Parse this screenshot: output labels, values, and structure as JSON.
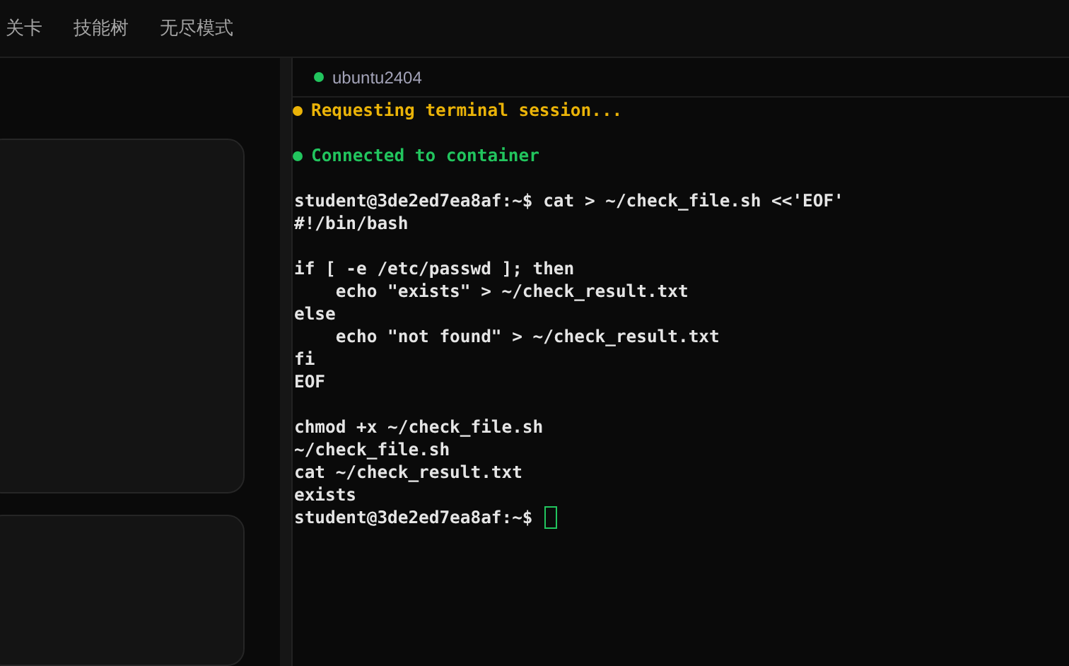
{
  "nav": [
    {
      "label": "关卡"
    },
    {
      "label": "技能树"
    },
    {
      "label": "无尽模式"
    }
  ],
  "terminal": {
    "tab": {
      "label": "ubuntu2404",
      "color": "#22c55e"
    },
    "blocks": [
      {
        "lines": [
          {
            "kind": "status",
            "text": "Requesting terminal session...",
            "color": "#eab308"
          }
        ]
      },
      {
        "lines": [
          {
            "kind": "status",
            "text": "Connected to container",
            "color": "#22c55e"
          }
        ]
      },
      {
        "lines": [
          {
            "kind": "text",
            "text": "student@3de2ed7ea8af:~$ cat > ~/check_file.sh <<'EOF'"
          },
          {
            "kind": "text",
            "text": "#!/bin/bash"
          }
        ]
      },
      {
        "lines": [
          {
            "kind": "text",
            "text": "if [ -e /etc/passwd ]; then"
          },
          {
            "kind": "text",
            "text": "    echo \"exists\" > ~/check_result.txt"
          },
          {
            "kind": "text",
            "text": "else"
          },
          {
            "kind": "text",
            "text": "    echo \"not found\" > ~/check_result.txt"
          },
          {
            "kind": "text",
            "text": "fi"
          },
          {
            "kind": "text",
            "text": "EOF"
          }
        ]
      },
      {
        "lines": [
          {
            "kind": "text",
            "text": "chmod +x ~/check_file.sh"
          },
          {
            "kind": "text",
            "text": "~/check_file.sh"
          },
          {
            "kind": "text",
            "text": "cat ~/check_result.txt"
          },
          {
            "kind": "text",
            "text": "exists"
          },
          {
            "kind": "prompt",
            "text": "student@3de2ed7ea8af:~$"
          }
        ]
      }
    ]
  }
}
